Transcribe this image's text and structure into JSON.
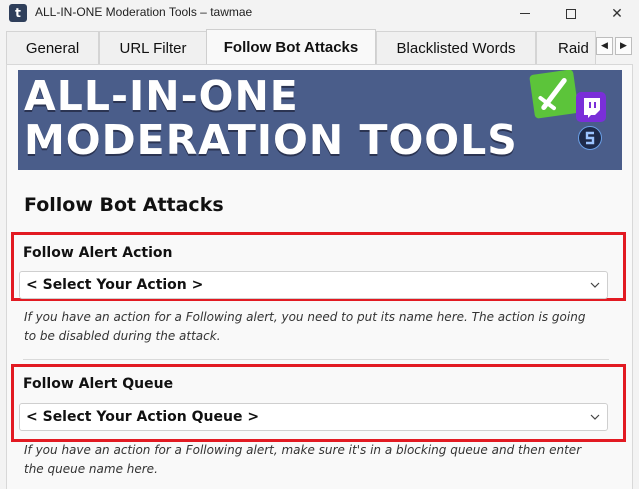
{
  "window": {
    "title": "ALL-IN-ONE Moderation Tools – tawmae",
    "app_icon_glyph": "t",
    "minimize_icon": "minimize-icon",
    "maximize_icon": "maximize-icon",
    "close_icon": "close-icon",
    "close_glyph": "✕"
  },
  "tabs": [
    {
      "label": "General",
      "active": false
    },
    {
      "label": "URL Filter",
      "active": false
    },
    {
      "label": "Follow Bot Attacks",
      "active": true
    },
    {
      "label": "Blacklisted Words",
      "active": false
    },
    {
      "label": "Raid",
      "active": false
    }
  ],
  "tab_scroll": {
    "left_glyph": "◀",
    "right_glyph": "▶"
  },
  "banner": {
    "line1": "ALL-IN-ONE",
    "line2": "MODERATION TOOLS",
    "background": "#4a5d8a"
  },
  "page": {
    "section_title": "Follow Bot Attacks"
  },
  "follow_alert_action": {
    "label": "Follow Alert Action",
    "selected": "< Select Your Action >",
    "help": "If you have an action for a Following alert, you need to put its name here. The action is going to be disabled during the attack."
  },
  "follow_alert_queue": {
    "label": "Follow Alert Queue",
    "selected": "< Select Your Action Queue >",
    "help": "If you have an action for a Following alert, make sure it's in a blocking queue and then enter the queue name here."
  },
  "colors": {
    "highlight_red": "#e21a22",
    "panel_bg": "#f9f9f9"
  }
}
